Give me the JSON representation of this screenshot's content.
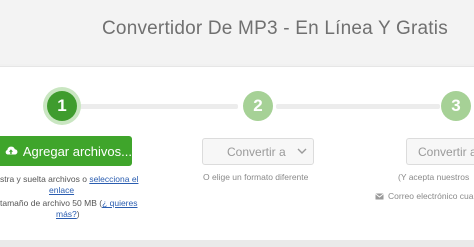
{
  "header": {
    "title": "Convertidor De MP3 - En Línea Y Gratis"
  },
  "steps": [
    {
      "number": "1",
      "state": "active"
    },
    {
      "number": "2",
      "state": "inactive"
    },
    {
      "number": "3",
      "state": "inactive"
    }
  ],
  "upload": {
    "button_label": "Agregar archivos...",
    "drop_text": "stra y suelta archivos o",
    "select_link": "selecciona el",
    "select_link_cont": "enlace",
    "size_text": "tamaño de archivo 50 MB (",
    "more_link": "¿ quieres",
    "more_link_cont": "más?",
    "size_text_end": ")"
  },
  "convert": {
    "select_label": "Convertir a",
    "select_hint": "O elige un formato diferente"
  },
  "step3": {
    "button_label": "Convertir al",
    "accept_text": "(Y acepta nuestros",
    "email_text": "Correo electrónico cuan"
  },
  "colors": {
    "accent_green": "#3fa52b",
    "step_active": "#3f9c2e",
    "step_inactive": "#a6d196",
    "link": "#2a5db0"
  },
  "icons": {
    "upload": "cloud-upload-icon",
    "select": "chevron-down-icon",
    "email": "envelope-icon"
  }
}
